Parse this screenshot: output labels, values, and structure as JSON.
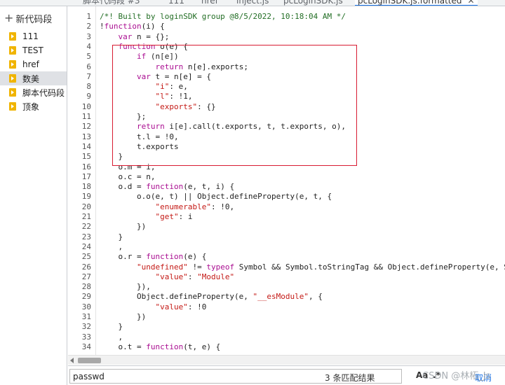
{
  "tabs": [
    {
      "label": "脚本代码段 #3"
    },
    {
      "label": "111"
    },
    {
      "label": "href"
    },
    {
      "label": "inject.js"
    },
    {
      "label": "pcLoginSDK.js"
    },
    {
      "label": "pcLoginSDK.js:formatted",
      "active": true
    }
  ],
  "navigator": {
    "new_snippet_label": "新代码段",
    "snippets": [
      {
        "label": "111"
      },
      {
        "label": "TEST"
      },
      {
        "label": "href"
      },
      {
        "label": "数美",
        "selected": true
      },
      {
        "label": "脚本代码段"
      },
      {
        "label": "顶象"
      }
    ]
  },
  "editor": {
    "line_numbers": [
      "1",
      "2",
      "3",
      "4",
      "5",
      "6",
      "7",
      "8",
      "9",
      "10",
      "11",
      "12",
      "13",
      "14",
      "15",
      "16",
      "17",
      "18",
      "19",
      "20",
      "21",
      "22",
      "23",
      "24",
      "25",
      "26",
      "27",
      "28",
      "29",
      "30",
      "31",
      "32",
      "33",
      "34"
    ],
    "lines": [
      "/*! Built by loginSDK group @8/5/2022, 10:18:04 AM */",
      "!function(i) {",
      "    var n = {};",
      "    function o(e) {",
      "        if (n[e])",
      "            return n[e].exports;",
      "        var t = n[e] = {",
      "            \"i\": e,",
      "            \"l\": !1,",
      "            \"exports\": {}",
      "        };",
      "        return i[e].call(t.exports, t, t.exports, o),",
      "        t.l = !0,",
      "        t.exports",
      "    }",
      "    o.m = i,",
      "    o.c = n,",
      "    o.d = function(e, t, i) {",
      "        o.o(e, t) || Object.defineProperty(e, t, {",
      "            \"enumerable\": !0,",
      "            \"get\": i",
      "        })",
      "    }",
      "    ,",
      "    o.r = function(e) {",
      "        \"undefined\" != typeof Symbol && Symbol.toStringTag && Object.defineProperty(e, Symbol.toStringTag, {",
      "            \"value\": \"Module\"",
      "        }),",
      "        Object.defineProperty(e, \"__esModule\", {",
      "            \"value\": !0",
      "        })",
      "    }",
      "    ,",
      "    o.t = function(t, e) {"
    ]
  },
  "search": {
    "value": "passwd",
    "match_count": "3 条匹配结果",
    "case_label": "Aa",
    "regex_label": ".*",
    "cancel_label": "取消"
  },
  "watermark": "CSDN @林柘_Js",
  "colors": {
    "keyword": "#aa0d91",
    "string": "#c41a16",
    "comment": "#236e25",
    "highlight_box": "#d81b32",
    "snippet_icon": "#f0b400"
  }
}
